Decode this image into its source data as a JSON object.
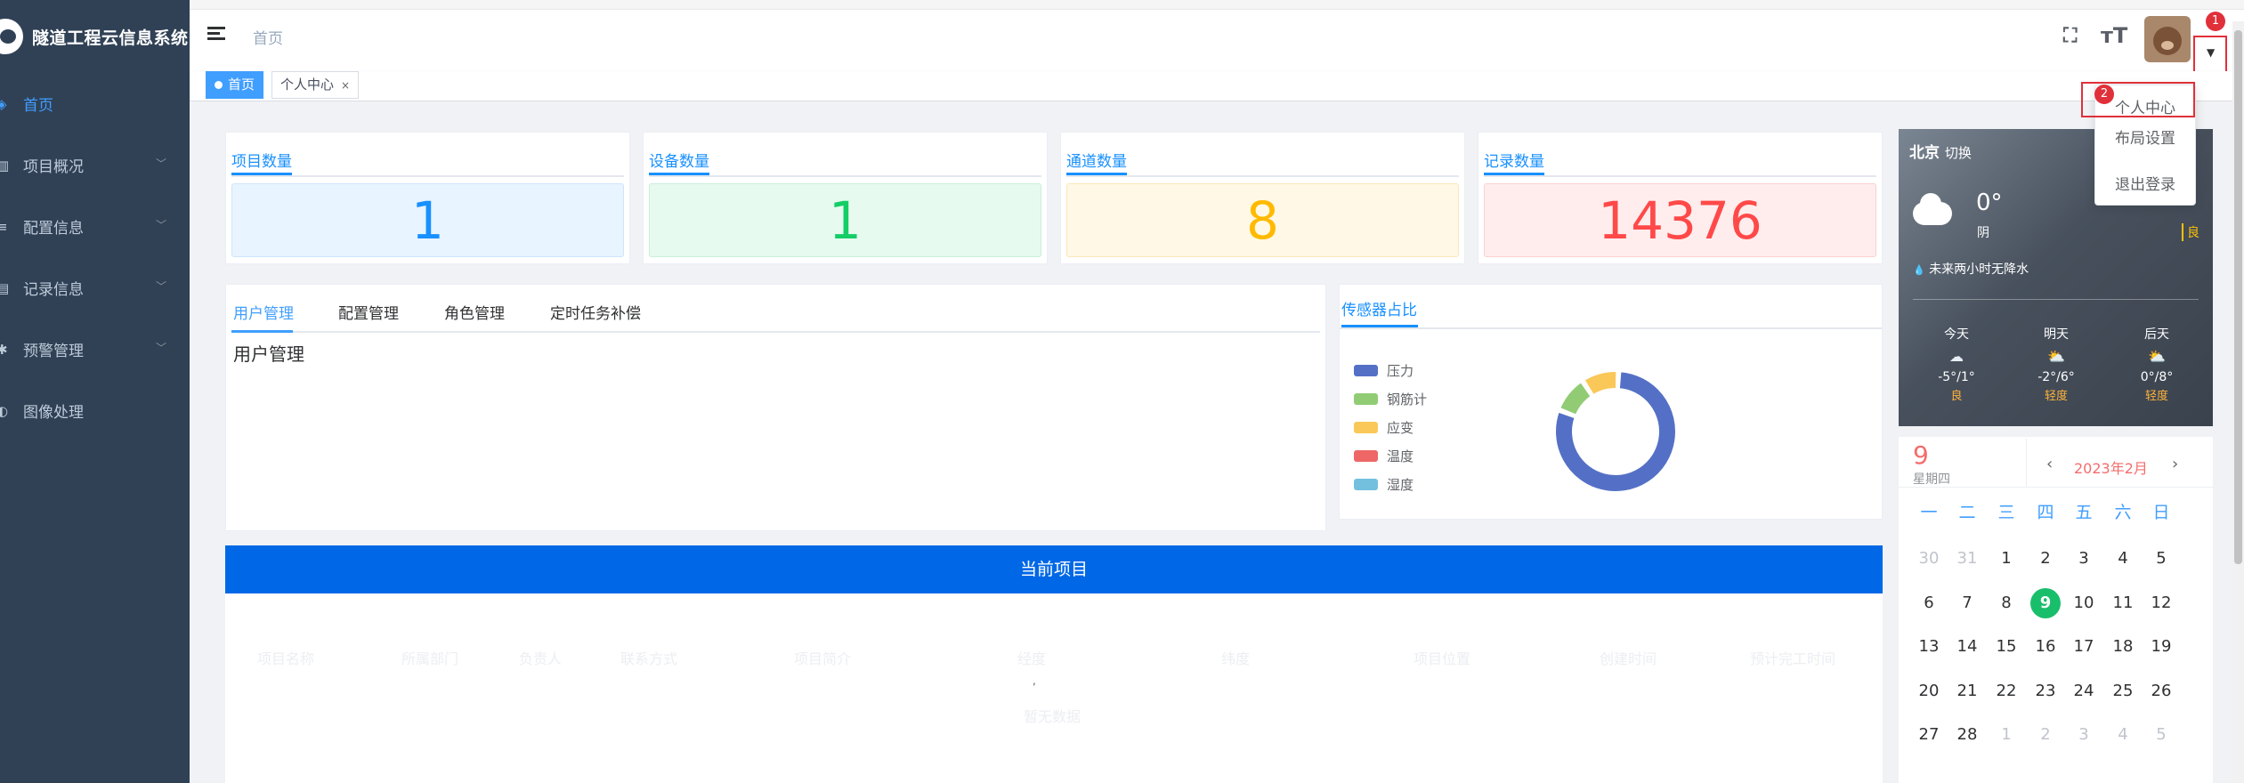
{
  "app": {
    "title": "隧道工程云信息系统"
  },
  "sidebar": {
    "items": [
      {
        "label": "首页",
        "icon": "dashboard-icon",
        "active": true,
        "has_children": false
      },
      {
        "label": "项目概况",
        "icon": "project-icon",
        "active": false,
        "has_children": true
      },
      {
        "label": "配置信息",
        "icon": "config-icon",
        "active": false,
        "has_children": true
      },
      {
        "label": "记录信息",
        "icon": "record-icon",
        "active": false,
        "has_children": true
      },
      {
        "label": "预警管理",
        "icon": "alarm-icon",
        "active": false,
        "has_children": true
      },
      {
        "label": "图像处理",
        "icon": "image-icon",
        "active": false,
        "has_children": false
      }
    ]
  },
  "navbar": {
    "breadcrumb": "首页",
    "badge1": "1",
    "badge2": "2"
  },
  "user_menu": {
    "items": [
      "个人中心",
      "布局设置",
      "退出登录"
    ]
  },
  "tags": {
    "items": [
      {
        "label": "首页",
        "active": true
      },
      {
        "label": "个人中心",
        "active": false,
        "close": "×"
      }
    ]
  },
  "stats": [
    {
      "title": "项目数量",
      "value": "1",
      "color": "#1890ff",
      "bg": "#e8f4ff",
      "border": "#cfe5fb"
    },
    {
      "title": "设备数量",
      "value": "1",
      "color": "#13ce66",
      "bg": "#e7faf0",
      "border": "#c8efd9"
    },
    {
      "title": "通道数量",
      "value": "8",
      "color": "#ffba00",
      "bg": "#fff8e6",
      "border": "#fbe8b8"
    },
    {
      "title": "记录数量",
      "value": "14376",
      "color": "#ff4949",
      "bg": "#ffeded",
      "border": "#fbd0d0"
    }
  ],
  "tabs": {
    "items": [
      "用户管理",
      "配置管理",
      "角色管理",
      "定时任务补偿"
    ],
    "active": 0,
    "content": "用户管理"
  },
  "sensor": {
    "title": "传感器占比",
    "legend": [
      {
        "name": "压力",
        "color": "#5470c6"
      },
      {
        "name": "钢筋计",
        "color": "#91cc75"
      },
      {
        "name": "应变",
        "color": "#fac858"
      },
      {
        "name": "温度",
        "color": "#ee6666"
      },
      {
        "name": "湿度",
        "color": "#73c0de"
      }
    ],
    "fractions": [
      0.8,
      0.1,
      0.1,
      0,
      0
    ]
  },
  "project": {
    "bar_title": "当前项目",
    "columns": [
      "项目名称",
      "所属部门",
      "负责人",
      "联系方式",
      "项目简介",
      "经度",
      "纬度",
      "项目位置",
      "创建时间",
      "预计完工时间"
    ],
    "empty": "暂无数据"
  },
  "weather": {
    "city": "北京",
    "switch": "切换",
    "temp": "0°",
    "desc": "阴",
    "aqi": "良",
    "forecast_text": "未来两小时无降水",
    "days": [
      {
        "label": "今天",
        "range": "-5°/1°",
        "aqi": "良",
        "icon": "rain-cloud-icon"
      },
      {
        "label": "明天",
        "range": "-2°/6°",
        "aqi": "轻度",
        "icon": "sun-cloud-icon"
      },
      {
        "label": "后天",
        "range": "0°/8°",
        "aqi": "轻度",
        "icon": "sun-cloud-icon"
      }
    ]
  },
  "calendar": {
    "day": "9",
    "weekday": "星期四",
    "month": "2023年2月",
    "weekdays": [
      "一",
      "二",
      "三",
      "四",
      "五",
      "六",
      "日"
    ],
    "rows": [
      [
        "30",
        "31",
        "1",
        "2",
        "3",
        "4",
        "5"
      ],
      [
        "6",
        "7",
        "8",
        "9",
        "10",
        "11",
        "12"
      ],
      [
        "13",
        "14",
        "15",
        "16",
        "17",
        "18",
        "19"
      ],
      [
        "20",
        "21",
        "22",
        "23",
        "24",
        "25",
        "26"
      ],
      [
        "27",
        "28",
        "1",
        "2",
        "3",
        "4",
        "5"
      ]
    ],
    "dim": [
      [
        0,
        0
      ],
      [
        0,
        1
      ],
      [
        4,
        2
      ],
      [
        4,
        3
      ],
      [
        4,
        4
      ],
      [
        4,
        5
      ],
      [
        4,
        6
      ]
    ],
    "today": [
      1,
      3
    ]
  }
}
